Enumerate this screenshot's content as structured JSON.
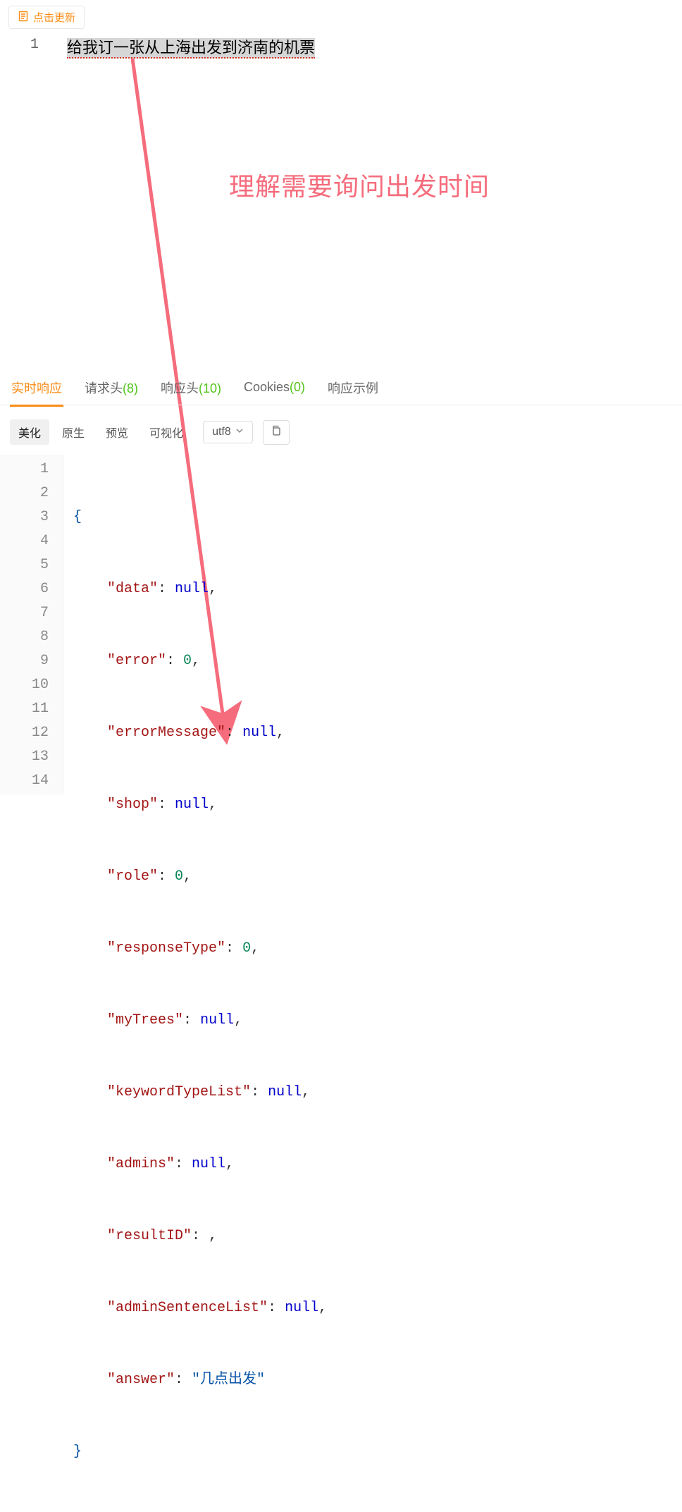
{
  "topButton": {
    "label": "点击更新"
  },
  "upperEditor": {
    "lineNumber": "1",
    "text": "给我订一张从上海出发到济南的机票"
  },
  "annotation": {
    "text": "理解需要询问出发时间"
  },
  "tabs": {
    "realtime": "实时响应",
    "requestHeader": "请求头",
    "requestHeaderCount": "(8)",
    "responseHeader": "响应头",
    "responseHeaderCount": "(10)",
    "cookies": "Cookies",
    "cookiesCount": "(0)",
    "responseExample": "响应示例"
  },
  "toolbar": {
    "beautify": "美化",
    "raw": "原生",
    "preview": "预览",
    "visualize": "可视化",
    "encoding": "utf8"
  },
  "code": {
    "lines": [
      "1",
      "2",
      "3",
      "4",
      "5",
      "6",
      "7",
      "8",
      "9",
      "10",
      "11",
      "12",
      "13",
      "14"
    ],
    "json": {
      "data": "null",
      "error": "0",
      "errorMessage": "null",
      "shop": "null",
      "role": "0",
      "responseType": "0",
      "myTrees": "null",
      "keywordTypeList": "null",
      "admins": "null",
      "resultID": "",
      "adminSentenceList": "null",
      "answer": "\"几点出发\""
    },
    "keys": {
      "data": "\"data\"",
      "error": "\"error\"",
      "errorMessage": "\"errorMessage\"",
      "shop": "\"shop\"",
      "role": "\"role\"",
      "responseType": "\"responseType\"",
      "myTrees": "\"myTrees\"",
      "keywordTypeList": "\"keywordTypeList\"",
      "admins": "\"admins\"",
      "resultID": "\"resultID\"",
      "adminSentenceList": "\"adminSentenceList\"",
      "answer": "\"answer\""
    }
  }
}
